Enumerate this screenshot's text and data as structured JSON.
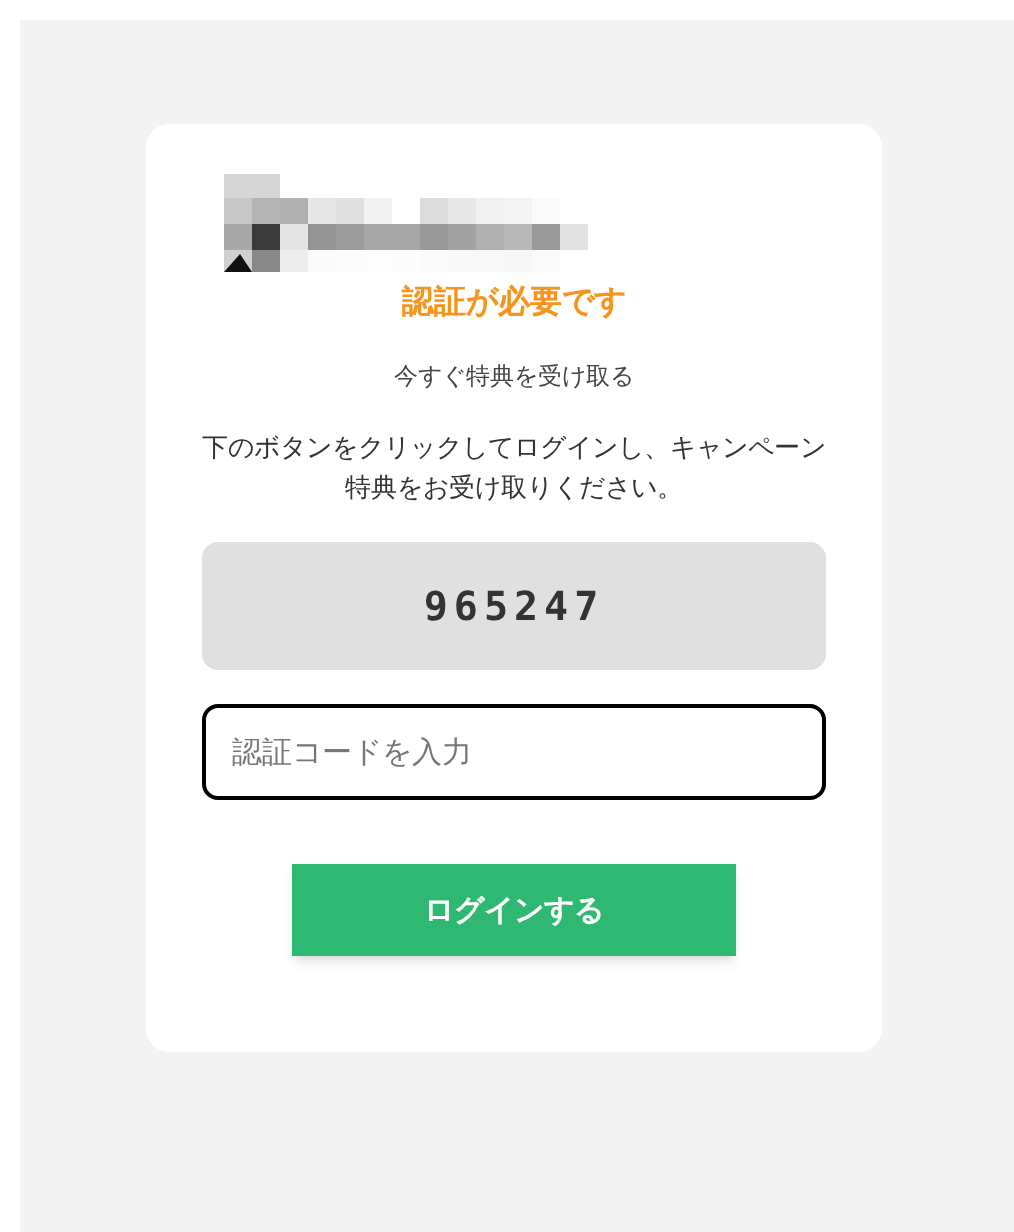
{
  "title": "認証が必要です",
  "subtitle": "今すぐ特典を受け取る",
  "message": "下のボタンをクリックしてログインし、キャンペーン特典をお受け取りください。",
  "code": "965247",
  "code_input": {
    "placeholder": "認証コードを入力"
  },
  "login_button": "ログインする"
}
